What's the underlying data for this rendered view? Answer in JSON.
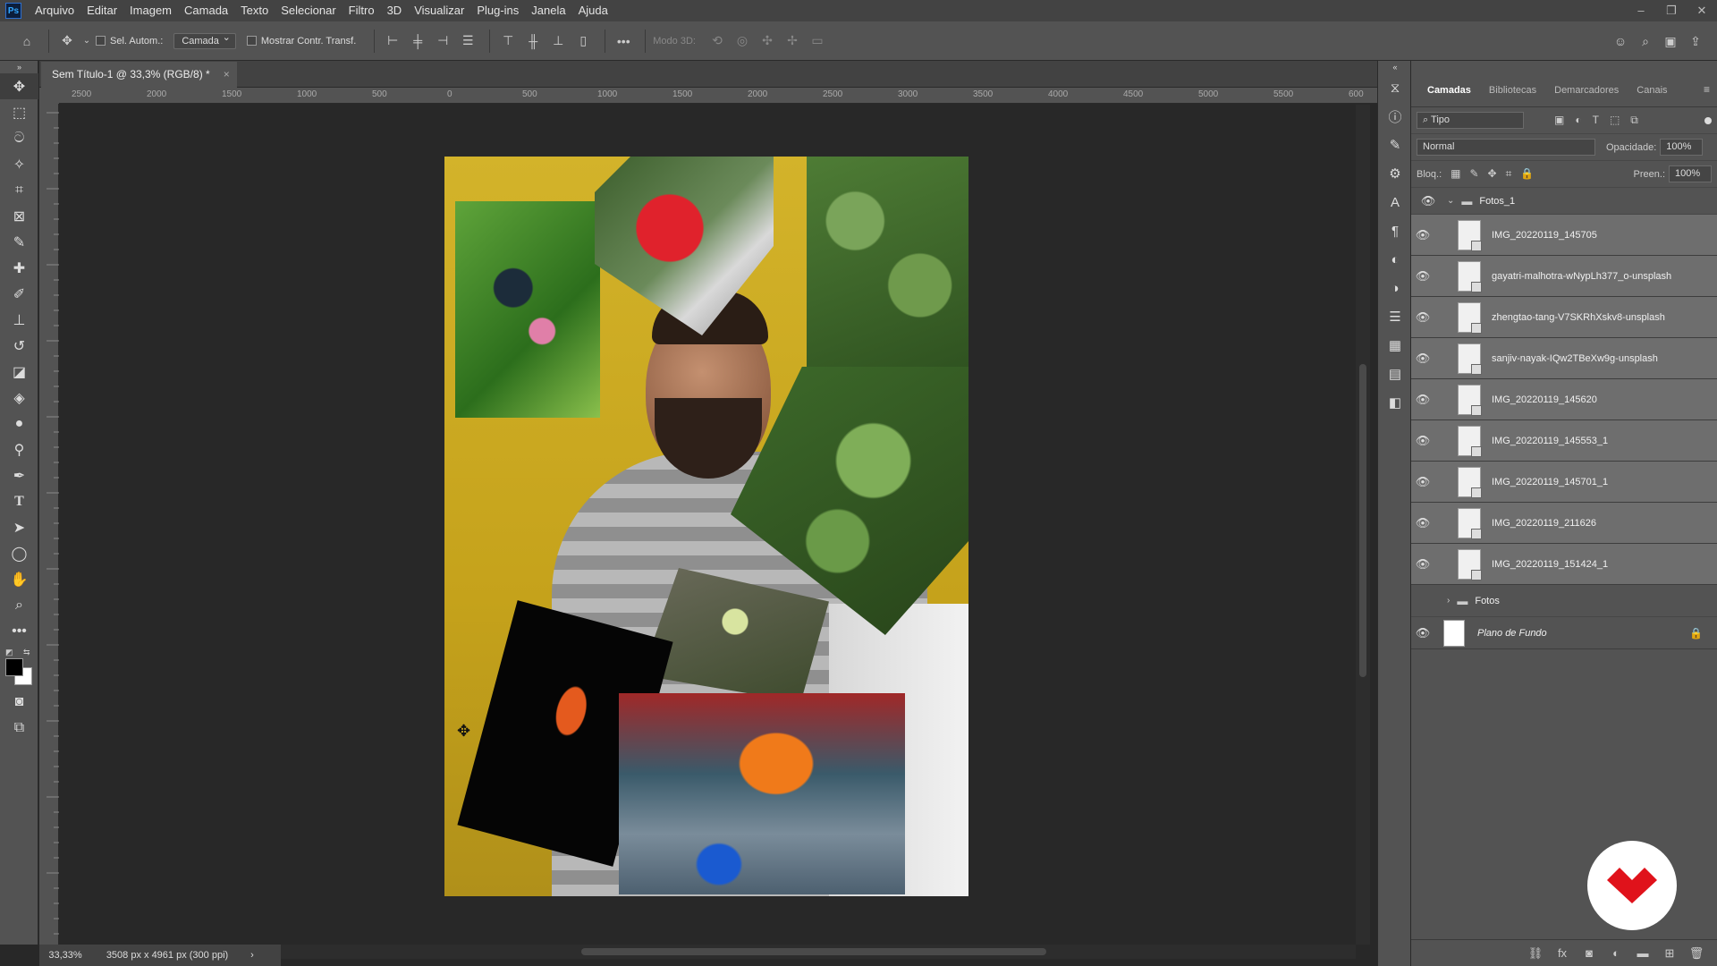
{
  "app": {
    "logo": "Ps"
  },
  "menu": [
    "Arquivo",
    "Editar",
    "Imagem",
    "Camada",
    "Texto",
    "Selecionar",
    "Filtro",
    "3D",
    "Visualizar",
    "Plug-ins",
    "Janela",
    "Ajuda"
  ],
  "window_controls": {
    "minimize": "–",
    "restore": "❐",
    "close": "✕"
  },
  "options": {
    "auto_select_label": "Sel. Autom.:",
    "auto_select_target": "Camada",
    "show_transform_label": "Mostrar Contr. Transf.",
    "mode3d_label": "Modo 3D:"
  },
  "document": {
    "tab_title": "Sem Título-1 @ 33,3% (RGB/8) *",
    "close": "×"
  },
  "ruler": {
    "top_ticks": [
      "2500",
      "2000",
      "1500",
      "1000",
      "500",
      "0",
      "500",
      "1000",
      "1500",
      "2000",
      "2500",
      "3000",
      "3500",
      "4000",
      "4500",
      "5000",
      "5500",
      "600"
    ]
  },
  "status": {
    "zoom": "33,33%",
    "doc_size": "3508 px x 4961 px (300 ppi)",
    "arrow": "›"
  },
  "layers_panel": {
    "tabs": [
      "Camadas",
      "Bibliotecas",
      "Demarcadores",
      "Canais"
    ],
    "filter_kind": "Tipo",
    "blend_mode": "Normal",
    "opacity_label": "Opacidade:",
    "opacity_value": "100%",
    "lock_label": "Bloq.:",
    "fill_label": "Preen.:",
    "fill_value": "100%",
    "group_open": "Fotos_1",
    "layers": [
      "IMG_20220119_145705",
      "gayatri-malhotra-wNypLh377_o-unsplash",
      "zhengtao-tang-V7SKRhXskv8-unsplash",
      "sanjiv-nayak-IQw2TBeXw9g-unsplash",
      "IMG_20220119_145620",
      "IMG_20220119_145553_1",
      "IMG_20220119_145701_1",
      "IMG_20220119_211626",
      "IMG_20220119_151424_1"
    ],
    "group_closed": "Fotos",
    "background": "Plano de Fundo"
  },
  "colors": {
    "accent_red": "#e0121b",
    "canvas_yellow": "#c9a81e"
  }
}
